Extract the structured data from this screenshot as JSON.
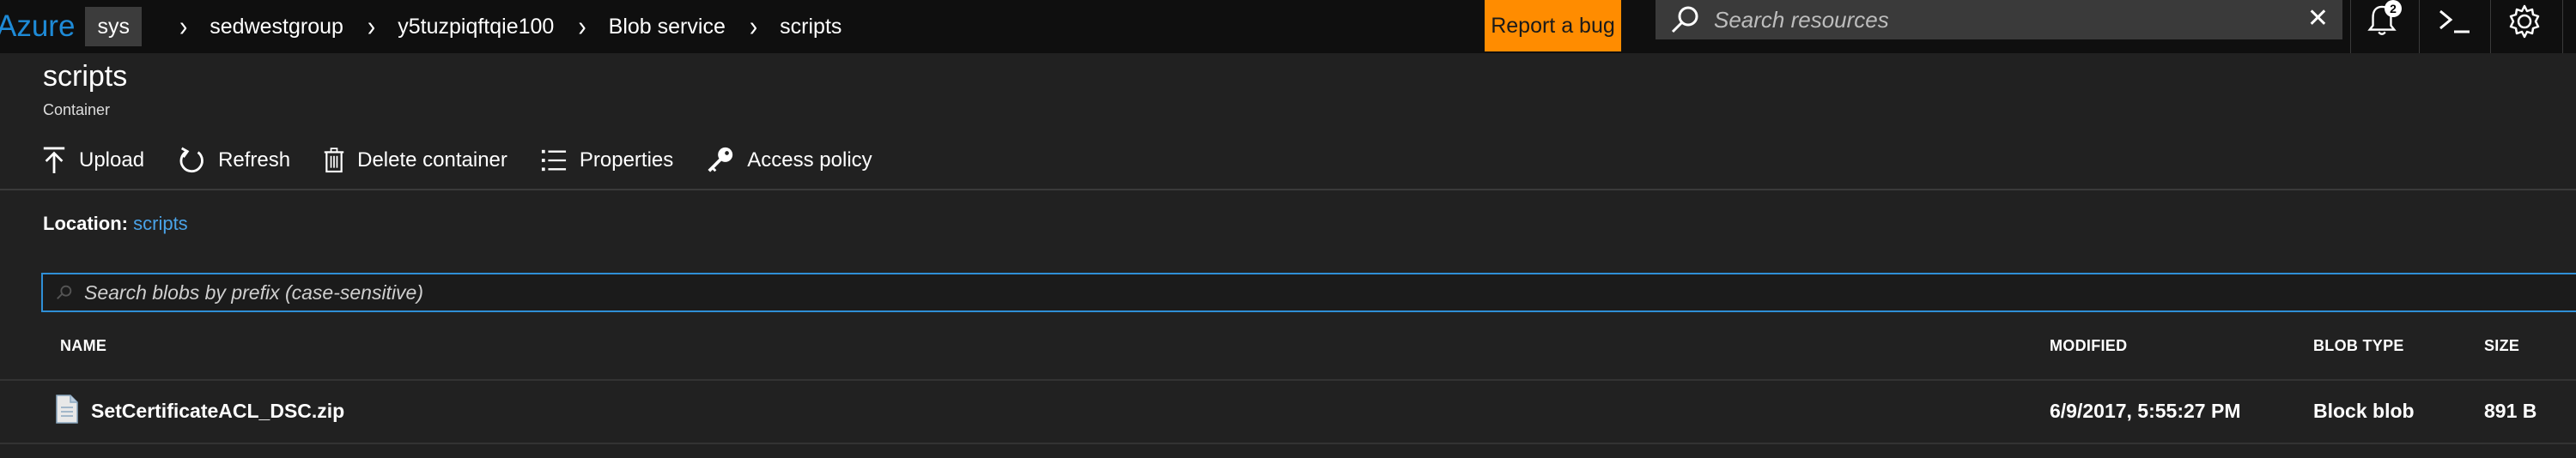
{
  "topbar": {
    "brand": "Azure",
    "active_crumb": "sys",
    "breadcrumbs": [
      "sedwestgroup",
      "y5tuzpiqftqie100",
      "Blob service",
      "scripts"
    ],
    "report_bug": "Report a bug",
    "search_placeholder": "Search resources",
    "notification_count": "2"
  },
  "header": {
    "title": "scripts",
    "subtitle": "Container"
  },
  "toolbar": {
    "upload": "Upload",
    "refresh": "Refresh",
    "delete": "Delete container",
    "properties": "Properties",
    "access_policy": "Access policy"
  },
  "location": {
    "label": "Location:",
    "value": "scripts"
  },
  "blob_search": {
    "placeholder": "Search blobs by prefix (case-sensitive)"
  },
  "table": {
    "columns": [
      "NAME",
      "MODIFIED",
      "BLOB TYPE",
      "SIZE"
    ],
    "rows": [
      {
        "name": "SetCertificateACL_DSC.zip",
        "modified": "6/9/2017, 5:55:27 PM",
        "blob_type": "Block blob",
        "size": "891 B"
      }
    ]
  },
  "colors": {
    "accent": "#1e8ad6",
    "report_bug_bg": "#ff8c00",
    "background": "#212121",
    "topbar_bg": "#0f0f0f",
    "link": "#4aa3e8"
  },
  "icons": [
    "search-icon",
    "close-icon",
    "bell-icon",
    "console-icon",
    "gear-icon",
    "upload-icon",
    "refresh-icon",
    "trash-icon",
    "list-icon",
    "key-icon",
    "file-icon"
  ]
}
